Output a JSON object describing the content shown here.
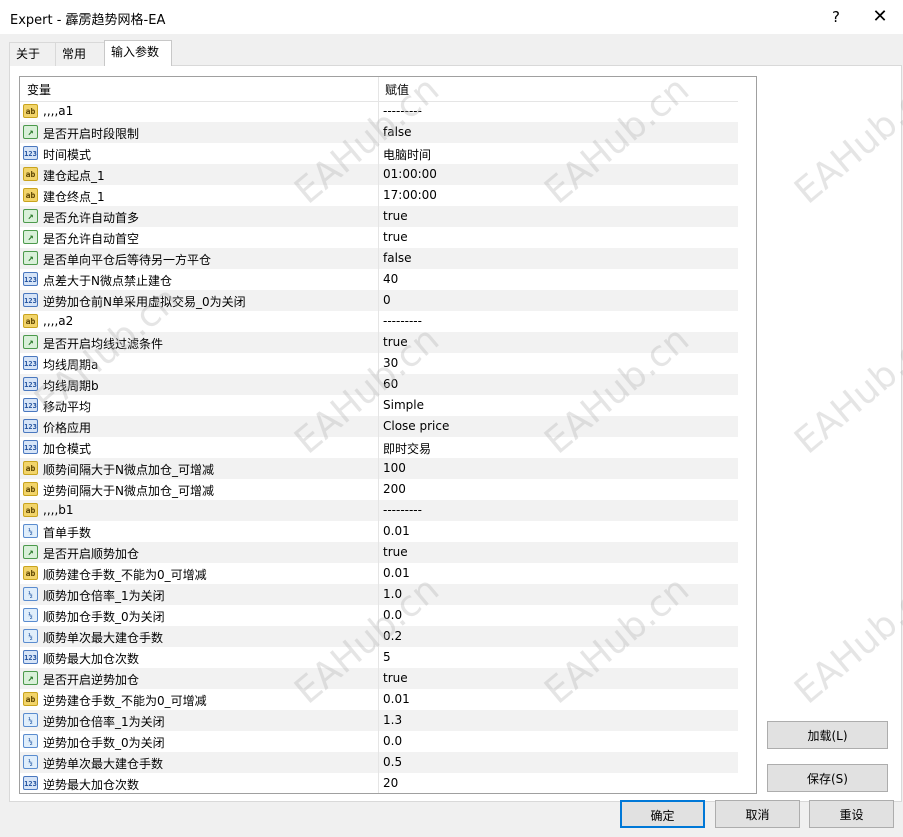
{
  "window": {
    "title": "Expert - 霹雳趋势网格-EA",
    "help_label": "?",
    "close_label": "✕"
  },
  "tabs": [
    {
      "label": "关于"
    },
    {
      "label": "常用"
    },
    {
      "label": "输入参数"
    }
  ],
  "grid": {
    "col_variable": "变量",
    "col_value": "赋值",
    "rows": [
      {
        "type": "ab",
        "name": ",,,,a1",
        "value": "---------"
      },
      {
        "type": "bool",
        "name": "是否开启时段限制",
        "value": "false"
      },
      {
        "type": "int",
        "name": "时间模式",
        "value": "电脑时间"
      },
      {
        "type": "ab",
        "name": "建仓起点_1",
        "value": "01:00:00"
      },
      {
        "type": "ab",
        "name": "建仓终点_1",
        "value": "17:00:00"
      },
      {
        "type": "bool",
        "name": "是否允许自动首多",
        "value": "true"
      },
      {
        "type": "bool",
        "name": "是否允许自动首空",
        "value": "true"
      },
      {
        "type": "bool",
        "name": "是否单向平仓后等待另一方平仓",
        "value": "false"
      },
      {
        "type": "int",
        "name": "点差大于N微点禁止建仓",
        "value": "40"
      },
      {
        "type": "int",
        "name": "逆势加仓前N单采用虚拟交易_0为关闭",
        "value": "0"
      },
      {
        "type": "ab",
        "name": ",,,,a2",
        "value": "---------"
      },
      {
        "type": "bool",
        "name": "是否开启均线过滤条件",
        "value": "true"
      },
      {
        "type": "int",
        "name": "均线周期a",
        "value": "30"
      },
      {
        "type": "int",
        "name": "均线周期b",
        "value": "60"
      },
      {
        "type": "int",
        "name": "移动平均",
        "value": "Simple"
      },
      {
        "type": "int",
        "name": "价格应用",
        "value": "Close price"
      },
      {
        "type": "int",
        "name": "加仓模式",
        "value": "即时交易"
      },
      {
        "type": "ab",
        "name": "顺势间隔大于N微点加仓_可增减",
        "value": "100"
      },
      {
        "type": "ab",
        "name": "逆势间隔大于N微点加仓_可增减",
        "value": "200"
      },
      {
        "type": "ab",
        "name": ",,,,b1",
        "value": "---------"
      },
      {
        "type": "dbl",
        "name": "首单手数",
        "value": "0.01"
      },
      {
        "type": "bool",
        "name": "是否开启顺势加仓",
        "value": "true"
      },
      {
        "type": "ab",
        "name": "顺势建仓手数_不能为0_可增减",
        "value": "0.01"
      },
      {
        "type": "dbl",
        "name": "顺势加仓倍率_1为关闭",
        "value": "1.0"
      },
      {
        "type": "dbl",
        "name": "顺势加仓手数_0为关闭",
        "value": "0.0"
      },
      {
        "type": "dbl",
        "name": "顺势单次最大建仓手数",
        "value": "0.2"
      },
      {
        "type": "int",
        "name": "顺势最大加仓次数",
        "value": "5"
      },
      {
        "type": "bool",
        "name": "是否开启逆势加仓",
        "value": "true"
      },
      {
        "type": "ab",
        "name": "逆势建仓手数_不能为0_可增减",
        "value": "0.01"
      },
      {
        "type": "dbl",
        "name": "逆势加仓倍率_1为关闭",
        "value": "1.3"
      },
      {
        "type": "dbl",
        "name": "逆势加仓手数_0为关闭",
        "value": "0.0"
      },
      {
        "type": "dbl",
        "name": "逆势单次最大建仓手数",
        "value": "0.5"
      },
      {
        "type": "int",
        "name": "逆势最大加仓次数",
        "value": "20"
      }
    ]
  },
  "icons": {
    "ab": "ab",
    "bool": "↗",
    "int": "123",
    "dbl": "½"
  },
  "buttons": {
    "load": "加载(L)",
    "save": "保存(S)",
    "ok": "确定",
    "cancel": "取消",
    "reset": "重设"
  },
  "watermark": "EAHub.cn"
}
